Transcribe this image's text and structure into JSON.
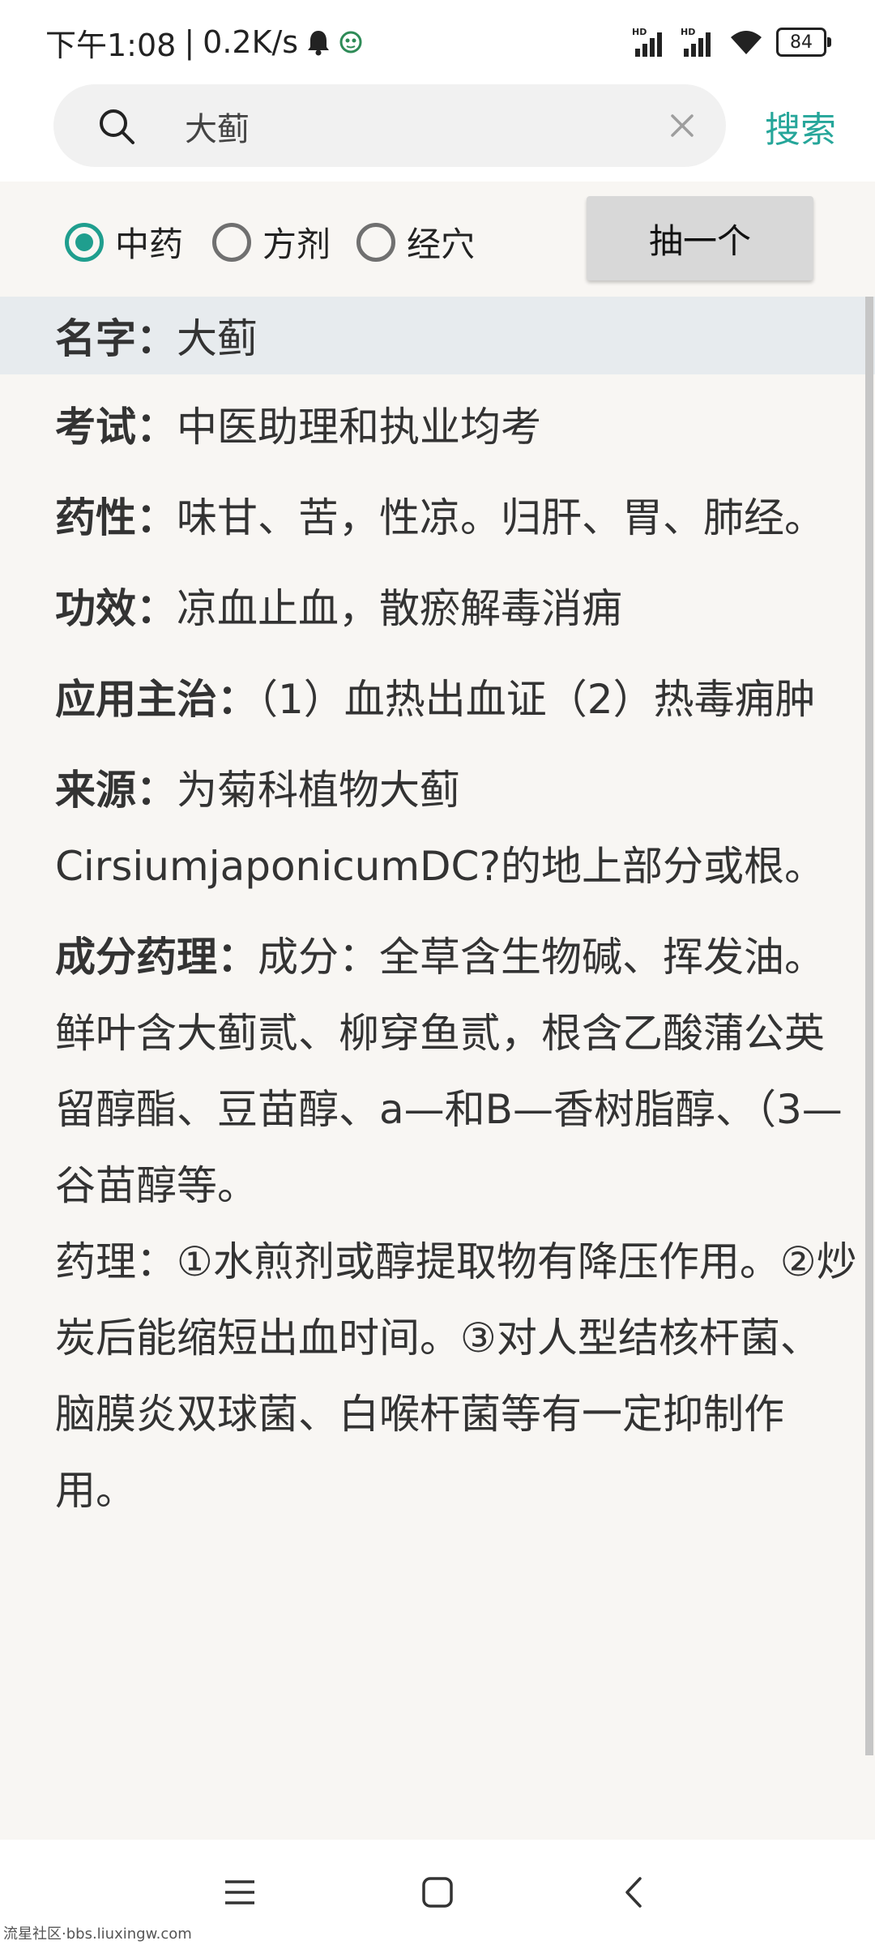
{
  "status_bar": {
    "time": "下午1:08",
    "speed": "0.2K/s",
    "battery": "84",
    "icons": [
      "bell-icon",
      "app-notification-icon",
      "hd-signal-icon",
      "hd-signal-icon",
      "wifi-icon",
      "battery-icon"
    ]
  },
  "search": {
    "value": "大蓟",
    "button_label": "搜索"
  },
  "category": {
    "options": [
      "中药",
      "方剂",
      "经穴"
    ],
    "selected": "中药",
    "random_button_label": "抽一个"
  },
  "entry": {
    "name_label": "名字：",
    "name": "大蓟",
    "exam_label": "考试：",
    "exam": "中医助理和执业均考",
    "nature_label": "药性：",
    "nature": "味甘、苦，性凉。归肝、胃、肺经。",
    "effect_label": "功效：",
    "effect": "凉血止血，散瘀解毒消痈",
    "indication_label": "应用主治：",
    "indication": "（1）血热出血证（2）热毒痈肿",
    "source_label": "来源：",
    "source": "为菊科植物大蓟CirsiumjaponicumDC?的地上部分或根。",
    "pharmacology_label": "成分药理：",
    "components": "成分：全草含生物碱、挥发油。鲜叶含大蓟贰、柳穿鱼贰，根含乙酸蒲公英留醇酯、豆苗醇、a—和B—香树脂醇、（3—谷苗醇等。",
    "pharmacology": "药理：①水煎剂或醇提取物有降压作用。②炒炭后能缩短出血时间。③对人型结核杆菌、脑膜炎双球菌、白喉杆菌等有一定抑制作用。"
  },
  "watermark": "流星社区·bbs.liuxingw.com",
  "colors": {
    "accent": "#26a69a",
    "radio_checked": "#1f9e8e",
    "name_row_bg": "#e7ebee",
    "page_bg": "#f8f6f3"
  }
}
